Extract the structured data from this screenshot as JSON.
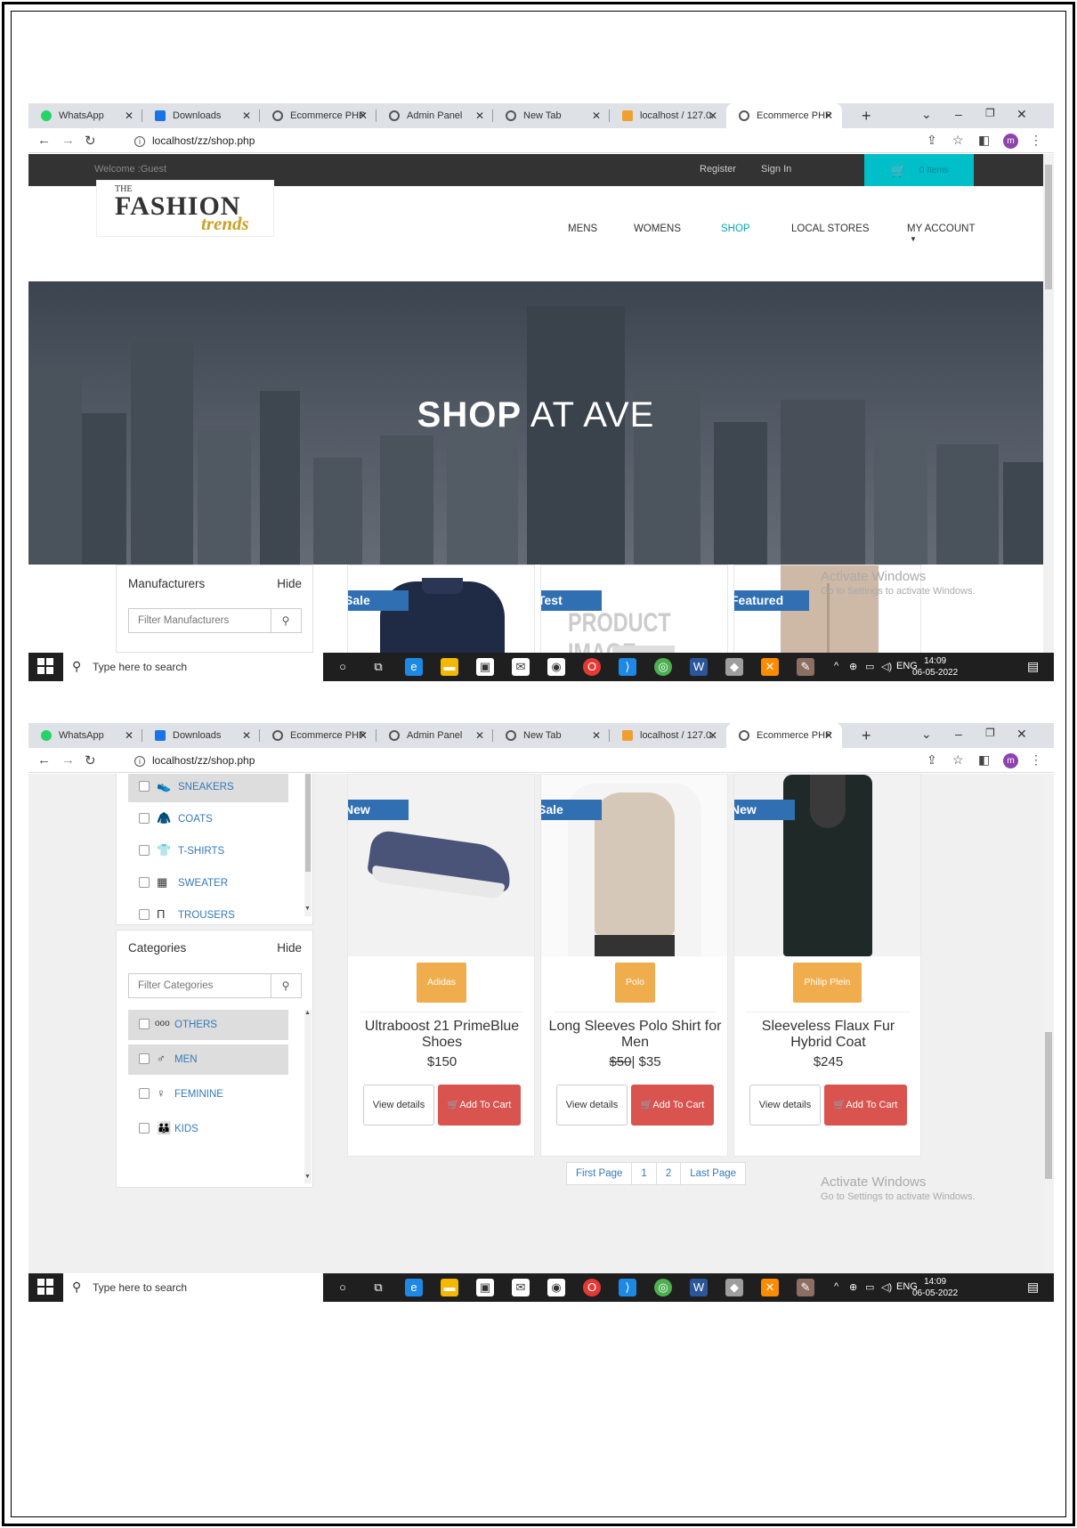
{
  "browser": {
    "tabs": [
      {
        "label": "WhatsApp",
        "color": "#25d366"
      },
      {
        "label": "Downloads",
        "color": "#1a73e8"
      },
      {
        "label": "Ecommerce PHP",
        "color": "#555555"
      },
      {
        "label": "Admin Panel",
        "color": "#555555"
      },
      {
        "label": "New Tab",
        "color": "#555555"
      },
      {
        "label": "localhost / 127.0.",
        "color": "#f0a030"
      },
      {
        "label": "Ecommerce PHP",
        "color": "#555555"
      }
    ],
    "new_tab": "+",
    "url": "localhost/zz/shop.php",
    "avatar": "m"
  },
  "site": {
    "welcome": "Welcome :Guest",
    "register": "Register",
    "sign_in": "Sign In",
    "cart": "0 Items",
    "logo_the": "THE",
    "logo_main": "FASHION",
    "logo_sub": "trends",
    "nav": [
      "MENS",
      "WOMENS",
      "SHOP",
      "LOCAL STORES",
      "MY ACCOUNT"
    ],
    "hero_bold": "SHOP",
    "hero_rest": " AT AVE"
  },
  "manufacturers": {
    "title": "Manufacturers",
    "hide": "Hide",
    "placeholder": "Filter Manufacturers"
  },
  "product_types": [
    {
      "label": "SNEAKERS",
      "icon": "sneaker-icon"
    },
    {
      "label": "COATS",
      "icon": "coat-icon"
    },
    {
      "label": "T-SHIRTS",
      "icon": "tshirt-icon"
    },
    {
      "label": "SWEATER",
      "icon": "sweater-icon"
    },
    {
      "label": "TROUSERS",
      "icon": "trousers-icon"
    }
  ],
  "categories": {
    "title": "Categories",
    "hide": "Hide",
    "placeholder": "Filter Categories",
    "items": [
      {
        "label": "OTHERS",
        "icon": "dots-icon"
      },
      {
        "label": "MEN",
        "icon": "male-icon"
      },
      {
        "label": "FEMININE",
        "icon": "female-icon"
      },
      {
        "label": "KIDS",
        "icon": "kids-icon"
      }
    ]
  },
  "top_products": [
    {
      "ribbon": "Sale"
    },
    {
      "ribbon": "Test",
      "image_text": "PRODUCT IMAGE"
    },
    {
      "ribbon": "Featured"
    }
  ],
  "products": [
    {
      "ribbon": "New",
      "brand": "Adidas",
      "name": "Ultraboost 21 PrimeBlue Shoes",
      "price": "$150",
      "old_price": ""
    },
    {
      "ribbon": "Sale",
      "brand": "Polo",
      "name": "Long Sleeves Polo Shirt for Men",
      "price": "| $35",
      "old_price": "$50"
    },
    {
      "ribbon": "New",
      "brand": "Philip Plein",
      "name": "Sleeveless Flaux Fur Hybrid Coat",
      "price": "$245",
      "old_price": ""
    }
  ],
  "buttons": {
    "view": "View details",
    "cart": "Add To Cart"
  },
  "pagination": [
    "First Page",
    "1",
    "2",
    "Last Page"
  ],
  "activate": {
    "line1": "Activate Windows",
    "line2": "Go to Settings to activate Windows."
  },
  "taskbar": {
    "search": "Type here to search",
    "lang": "ENG",
    "time": "14:09",
    "date": "06-05-2022"
  }
}
